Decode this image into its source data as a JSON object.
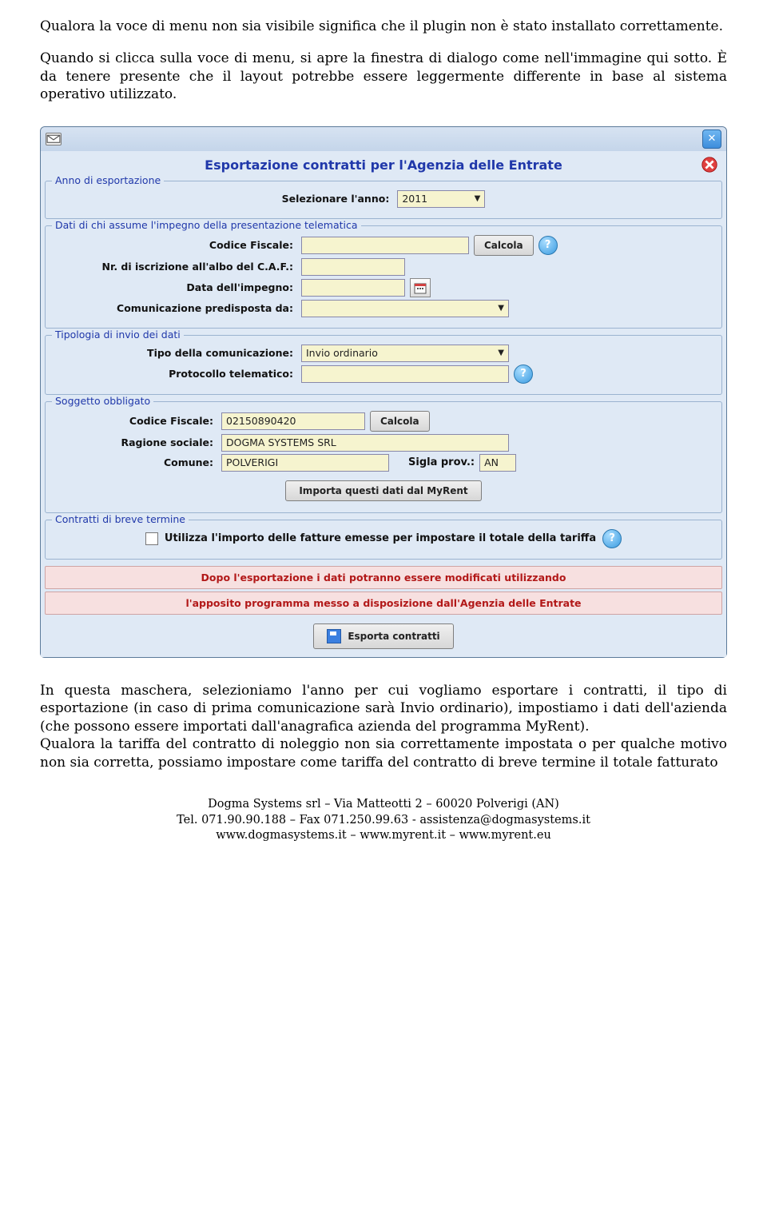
{
  "intro": {
    "p1": "Qualora la voce di menu non sia visibile significa che il plugin non è stato installato correttamente.",
    "p2": "Quando si clicca sulla voce di menu, si apre la finestra di dialogo come nell'immagine qui sotto. È da tenere presente che il layout potrebbe essere leggermente differente in base al sistema operativo utilizzato."
  },
  "dialog": {
    "title": "Esportazione contratti per l'Agenzia delle Entrate",
    "section_year": {
      "legend": "Anno di esportazione",
      "label_year": "Selezionare l'anno:",
      "year_value": "2011"
    },
    "section_presenter": {
      "legend": "Dati di chi assume l'impegno della presentazione telematica",
      "label_cf": "Codice Fiscale:",
      "btn_calcola": "Calcola",
      "label_caf": "Nr. di iscrizione all'albo del C.A.F.:",
      "label_date": "Data dell'impegno:",
      "label_comm": "Comunicazione predisposta da:"
    },
    "section_type": {
      "legend": "Tipologia di invio dei dati",
      "label_type": "Tipo della comunicazione:",
      "type_value": "Invio ordinario",
      "label_proto": "Protocollo telematico:"
    },
    "section_subject": {
      "legend": "Soggetto obbligato",
      "label_cf": "Codice Fiscale:",
      "cf_value": "02150890420",
      "btn_calcola": "Calcola",
      "label_ragione": "Ragione sociale:",
      "ragione_value": "DOGMA SYSTEMS SRL",
      "label_comune": "Comune:",
      "comune_value": "POLVERIGI",
      "label_sigla": "Sigla prov.:",
      "sigla_value": "AN",
      "btn_import": "Importa questi dati dal MyRent"
    },
    "section_short": {
      "legend": "Contratti di breve termine",
      "check_label": "Utilizza l'importo delle fatture emesse per impostare il totale della tariffa"
    },
    "banner1": "Dopo l'esportazione i dati potranno essere modificati utilizzando",
    "banner2": "l'apposito programma messo a disposizione dall'Agenzia delle Entrate",
    "btn_export": "Esporta contratti"
  },
  "outro": {
    "p1": "In questa maschera, selezioniamo l'anno per cui vogliamo esportare i contratti, il tipo di esportazione (in caso di prima comunicazione sarà Invio ordinario), impostiamo i dati dell'azienda (che possono essere importati dall'anagrafica azienda del programma MyRent).",
    "p2": "Qualora la tariffa del contratto di noleggio non sia correttamente impostata o per qualche motivo non sia corretta, possiamo impostare come tariffa del contratto di breve termine il totale fatturato"
  },
  "footer": {
    "l1": "Dogma Systems srl – Via Matteotti 2 – 60020 Polverigi (AN)",
    "l2": "Tel. 071.90.90.188 – Fax 071.250.99.63 - assistenza@dogmasystems.it",
    "l3": "www.dogmasystems.it – www.myrent.it – www.myrent.eu"
  }
}
